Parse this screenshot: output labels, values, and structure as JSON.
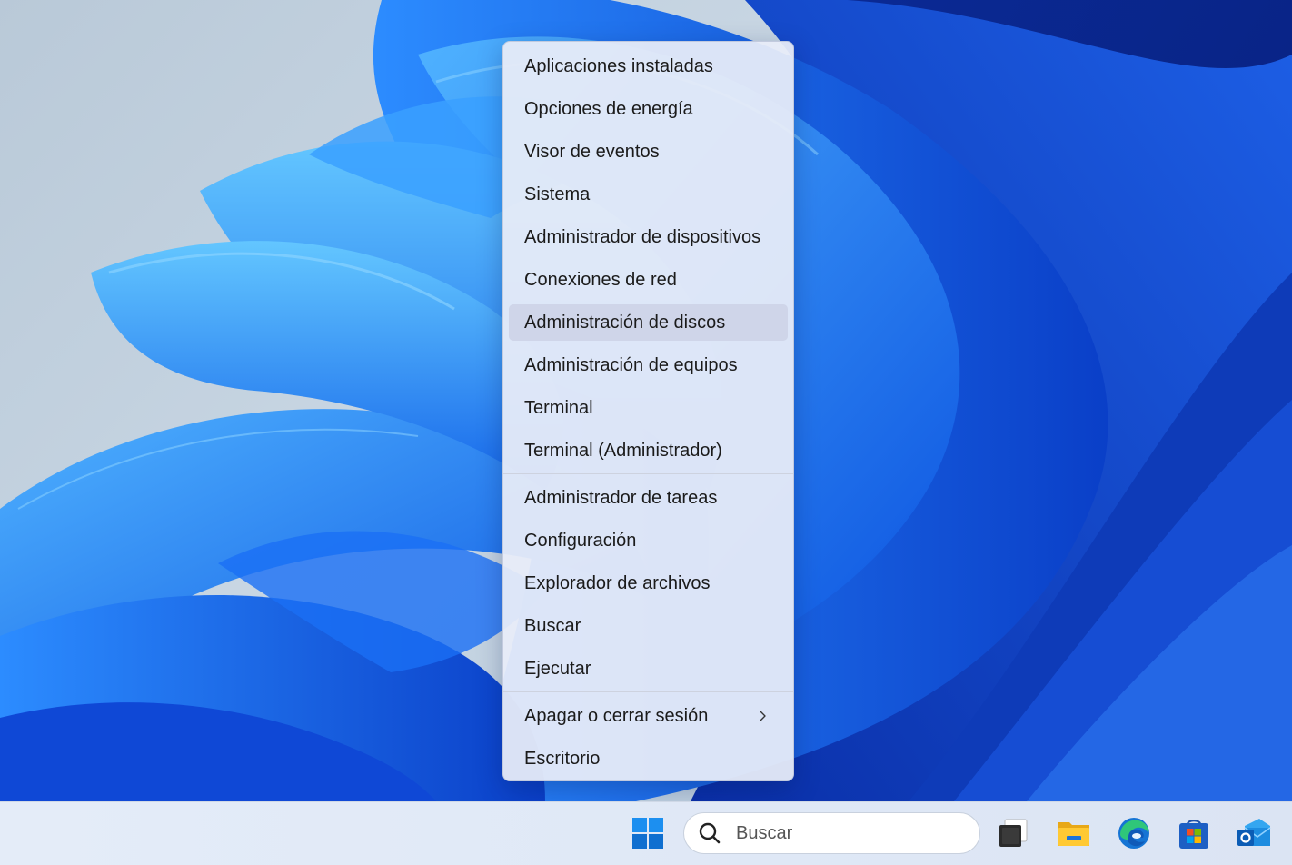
{
  "context_menu": {
    "group1": [
      {
        "label": "Aplicaciones instaladas"
      },
      {
        "label": "Opciones de energía"
      },
      {
        "label": "Visor de eventos"
      },
      {
        "label": "Sistema"
      },
      {
        "label": "Administrador de dispositivos"
      },
      {
        "label": "Conexiones de red"
      },
      {
        "label": "Administración de discos",
        "state": "hover"
      },
      {
        "label": "Administración de equipos"
      },
      {
        "label": "Terminal"
      },
      {
        "label": "Terminal (Administrador)"
      }
    ],
    "group2": [
      {
        "label": "Administrador de tareas"
      },
      {
        "label": "Configuración"
      },
      {
        "label": "Explorador de archivos"
      },
      {
        "label": "Buscar"
      },
      {
        "label": "Ejecutar"
      }
    ],
    "group3": [
      {
        "label": "Apagar o cerrar sesión",
        "submenu_icon": "chevron-right-icon"
      },
      {
        "label": "Escritorio"
      }
    ]
  },
  "taskbar": {
    "search": {
      "placeholder": "Buscar",
      "value": ""
    },
    "icons": [
      {
        "name": "start-icon"
      },
      {
        "name": "search-icon"
      },
      {
        "name": "task-view-icon"
      },
      {
        "name": "file-explorer-icon"
      },
      {
        "name": "edge-icon"
      },
      {
        "name": "microsoft-store-icon"
      },
      {
        "name": "outlook-icon"
      }
    ]
  },
  "colors": {
    "wallpaper_blue": "#1f6df0",
    "menu_bg": "#e8ecf8",
    "hover_bg": "#cdd4e8",
    "taskbar_bg": "#e4ecf8",
    "start_blue": "#0f78d4"
  }
}
